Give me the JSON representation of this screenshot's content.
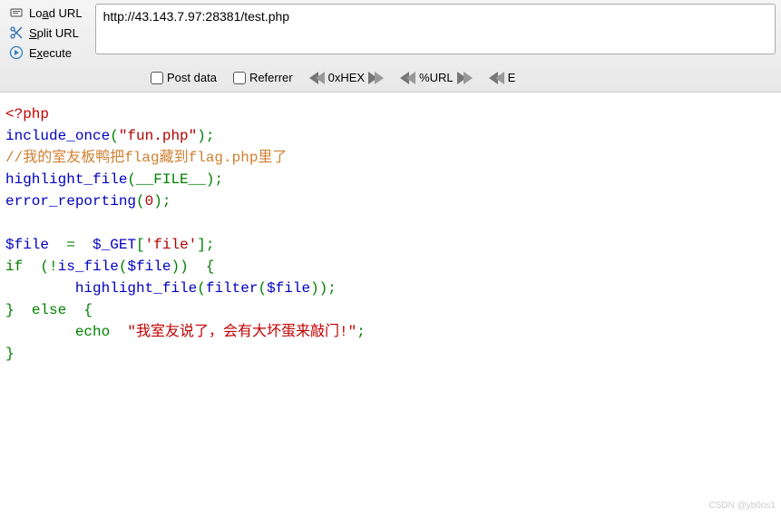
{
  "toolbar": {
    "load_url_label": "Load URL",
    "split_url_label": "Split URL",
    "execute_label": "Execute",
    "url_value": "http://43.143.7.97:28381/test.php",
    "post_data_label": "Post data",
    "referrer_label": "Referrer",
    "hex_label": "0xHEX",
    "url_encode_label": "%URL"
  },
  "code": {
    "open_tag": "<?php",
    "include": "include_once",
    "include_arg": "\"fun.php\"",
    "comment": "//我的室友板鸭把flag藏到flag.php里了",
    "highlight": "highlight_file",
    "file_const": "__FILE__",
    "error_rep": "error_reporting",
    "zero": "0",
    "file_var": "$file",
    "get_var": "$_GET",
    "get_key": "'file'",
    "if_kw": "if",
    "is_file": "is_file",
    "filter": "filter",
    "else_kw": "else",
    "echo_kw": "echo",
    "echo_str": "\"我室友说了，会有大坏蛋来敲门!\"",
    "eq": "  =  ",
    "semi": ";"
  },
  "watermark": "CSDN @yb0os1"
}
